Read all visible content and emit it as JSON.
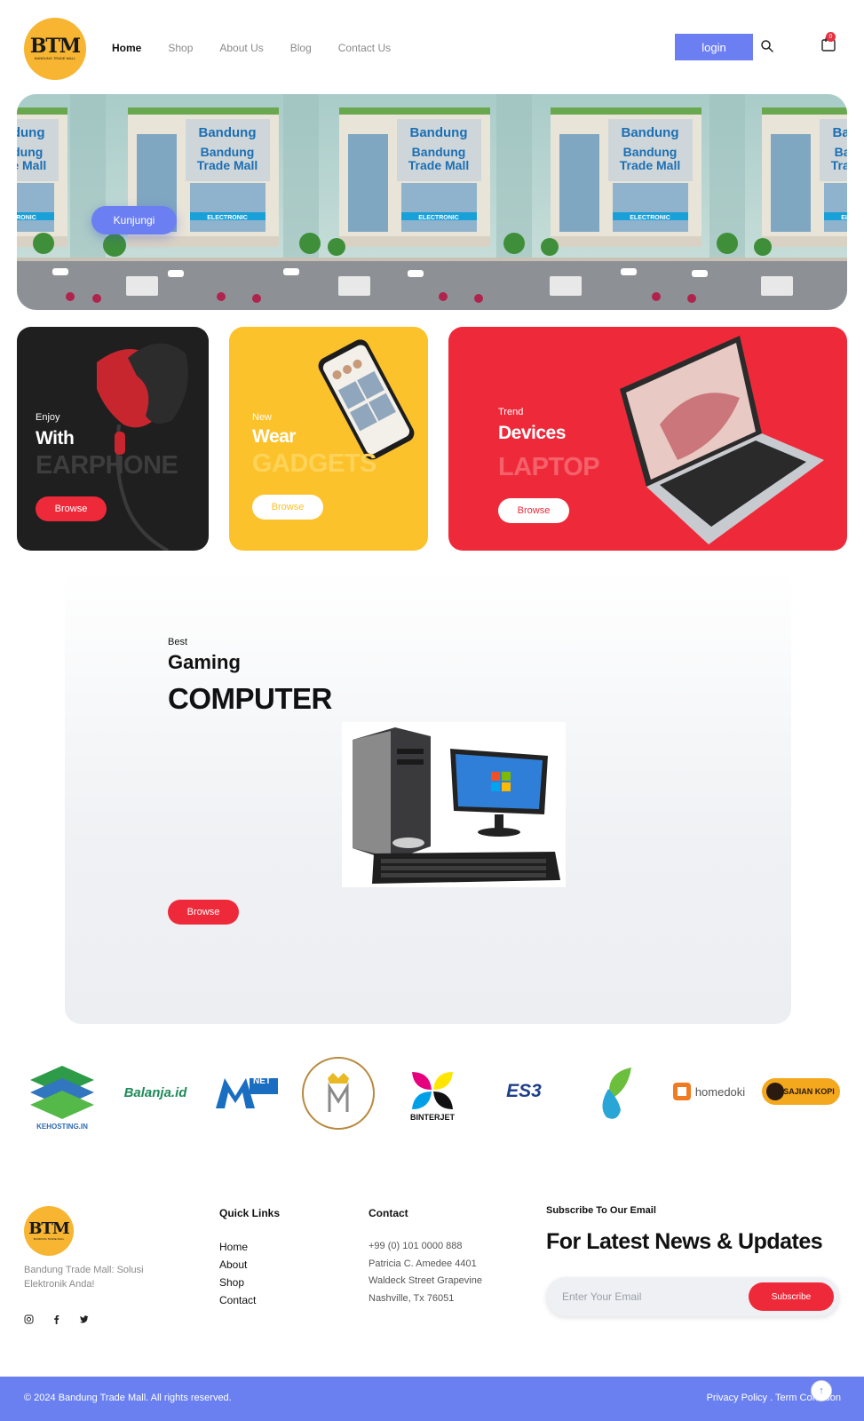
{
  "header": {
    "logo_text": "BTM",
    "logo_subtext": "BANDUNG TRADE MALL",
    "nav": [
      "Home",
      "Shop",
      "About Us",
      "Blog",
      "Contact Us"
    ],
    "login_label": "login",
    "cart_count": "0"
  },
  "hero": {
    "cta_label": "Kunjungi"
  },
  "cards": [
    {
      "kicker": "Enjoy",
      "title": "With",
      "big": "EARPHONE",
      "button": "Browse"
    },
    {
      "kicker": "New",
      "title": "Wear",
      "big": "GADGETS",
      "button": "Browse"
    },
    {
      "kicker": "Trend",
      "title": "Devices",
      "big": "LAPTOP",
      "button": "Browse"
    }
  ],
  "gaming": {
    "kicker": "Best",
    "title": "Gaming",
    "big": "COMPUTER",
    "button": "Browse"
  },
  "partners": [
    "KEHOSTING.IN",
    "Balanja.id",
    "NET",
    "BINTERJET",
    "ES3",
    "homedoki",
    "SAJIAN KOPI"
  ],
  "footer": {
    "tagline": "Bandung Trade Mall: Solusi Elektronik Anda!",
    "quick_links_title": "Quick Links",
    "quick_links": [
      "Home",
      "About",
      "Shop",
      "Contact"
    ],
    "contact_title": "Contact",
    "contact_lines": [
      "+99 (0) 101 0000 888",
      "Patricia C. Amedee 4401",
      "Waldeck Street Grapevine",
      "Nashville, Tx 76051"
    ],
    "subscribe_kicker": "Subscribe To Our Email",
    "subscribe_title": "For Latest News & Updates",
    "email_placeholder": "Enter Your Email",
    "subscribe_button": "Subscribe",
    "copyright": "© 2024 Bandung Trade Mall. All rights reserved.",
    "privacy": "Privacy Policy",
    "terms": "Term Condition"
  },
  "colors": {
    "accent_blue": "#6c7ff2",
    "red": "#ee2a3a",
    "yellow": "#fcc22c",
    "logo_orange": "#f7b531"
  }
}
